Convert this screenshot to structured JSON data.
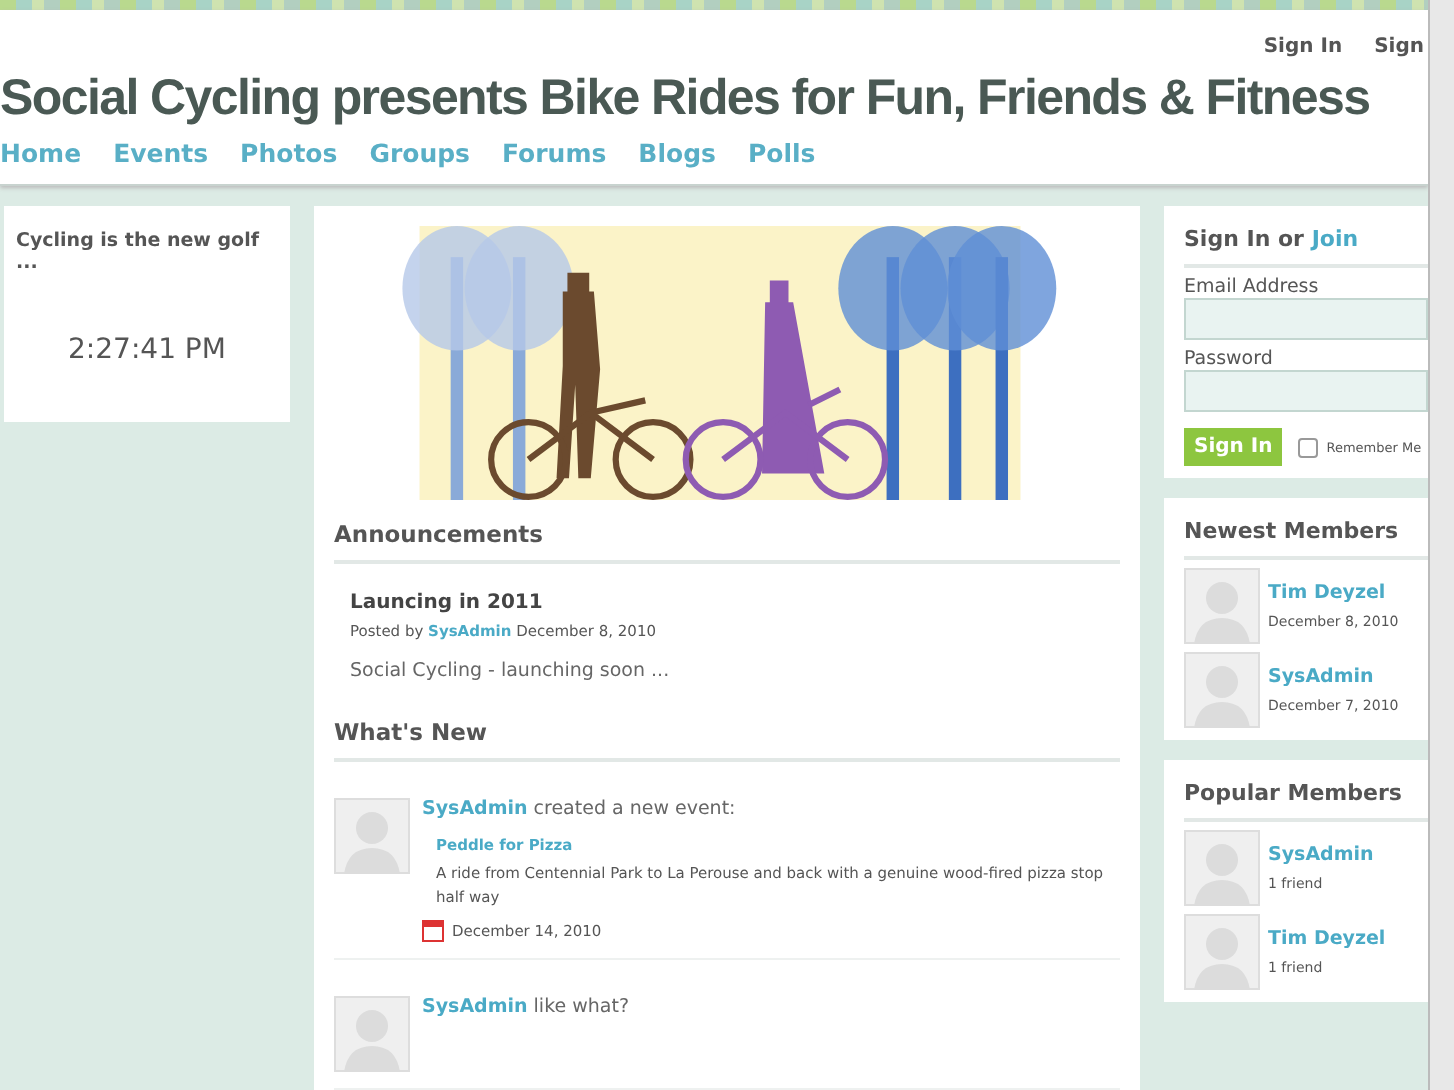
{
  "header": {
    "top_links": [
      "Sign In",
      "Sign"
    ],
    "title": "Social Cycling presents Bike Rides for Fun, Friends & Fitness",
    "nav": [
      {
        "label": "Home",
        "selected": false
      },
      {
        "label": "Events",
        "selected": false
      },
      {
        "label": "Photos",
        "selected": false
      },
      {
        "label": "Groups",
        "selected": false
      },
      {
        "label": "Forums",
        "selected": false
      },
      {
        "label": "Blogs",
        "selected": false
      },
      {
        "label": "Polls",
        "selected": false
      }
    ]
  },
  "left": {
    "title": "Cycling is the new golf ...",
    "time": "2:27:41 PM"
  },
  "announcements": {
    "heading": "Announcements",
    "items": [
      {
        "title": "Launcing in 2011",
        "posted_by": "Posted by",
        "author": "SysAdmin",
        "date": "December 8, 2010",
        "body": "Social Cycling - launching soon ..."
      }
    ]
  },
  "whats_new": {
    "heading": "What's New",
    "items": [
      {
        "user": "SysAdmin",
        "action": "created a new event:",
        "event": "Peddle for Pizza",
        "description": "A ride from Centennial Park to La Perouse and back with a genuine wood-fired pizza stop half way",
        "date": "December 14, 2010"
      },
      {
        "user": "SysAdmin",
        "action": "like what?"
      }
    ]
  },
  "sign_in": {
    "heading": "Sign In or",
    "join": "Join",
    "email_label": "Email Address",
    "password_label": "Password",
    "button": "Sign In",
    "remember": {
      "label": "Remember Me",
      "checked": false
    }
  },
  "newest_members": {
    "heading": "Newest Members",
    "members": [
      {
        "name": "Tim Deyzel",
        "detail": "December 8, 2010"
      },
      {
        "name": "SysAdmin",
        "detail": "December 7, 2010"
      }
    ]
  },
  "popular_members": {
    "heading": "Popular Members",
    "members": [
      {
        "name": "SysAdmin",
        "detail": "1 friend"
      },
      {
        "name": "Tim Deyzel",
        "detail": "1 friend"
      }
    ]
  }
}
